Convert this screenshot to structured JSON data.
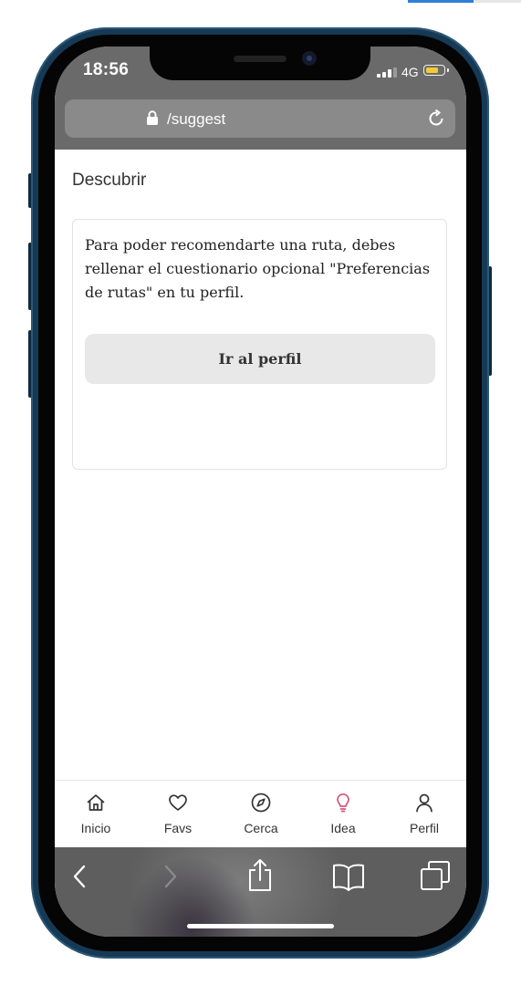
{
  "status_bar": {
    "time": "18:56",
    "network": "4G"
  },
  "browser": {
    "url": "/suggest"
  },
  "page": {
    "title": "Descubrir",
    "message": "Para poder recomendarte una ruta, debes rellenar el cuestionario opcional \"Preferencias de rutas\" en tu perfil.",
    "profile_button": "Ir al perfil"
  },
  "tabs": [
    {
      "label": "Inicio",
      "icon": "home-icon"
    },
    {
      "label": "Favs",
      "icon": "heart-icon"
    },
    {
      "label": "Cerca",
      "icon": "compass-icon"
    },
    {
      "label": "Idea",
      "icon": "lightbulb-icon",
      "active": true
    },
    {
      "label": "Perfil",
      "icon": "user-icon"
    }
  ],
  "colors": {
    "active_tab": "#d6577a",
    "status_bar_bg": "#6a6a6a",
    "battery": "#f2cc30"
  }
}
